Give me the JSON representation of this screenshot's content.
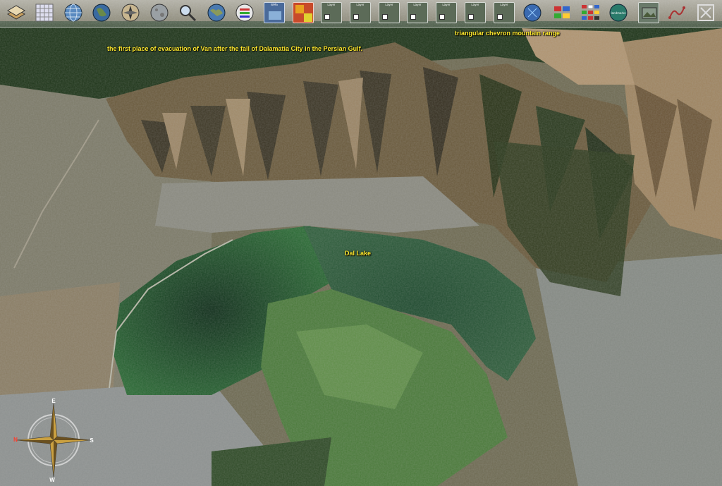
{
  "toolbar": {
    "buttons": [
      {
        "name": "layers-icon"
      },
      {
        "name": "grid-icon"
      },
      {
        "name": "globe-grid-icon"
      },
      {
        "name": "earth-icon"
      },
      {
        "name": "navigation-icon"
      },
      {
        "name": "moon-icon"
      },
      {
        "name": "search-icon"
      },
      {
        "name": "world-map-icon"
      },
      {
        "name": "wms-server-icon"
      }
    ],
    "layer_buttons": [
      {
        "name": "wms-layer-icon",
        "caption": "WMS"
      },
      {
        "name": "heatmap-layer-icon",
        "caption": ""
      },
      {
        "name": "layer-thumb-1-icon",
        "caption": "Layer"
      },
      {
        "name": "layer-thumb-2-icon",
        "caption": "Layer"
      },
      {
        "name": "layer-thumb-3-icon",
        "caption": "Layer"
      },
      {
        "name": "layer-thumb-4-icon",
        "caption": "Layer"
      },
      {
        "name": "layer-thumb-5-icon",
        "caption": "Layer"
      },
      {
        "name": "layer-thumb-6-icon",
        "caption": "Layer"
      },
      {
        "name": "layer-thumb-7-icon",
        "caption": "Layer"
      }
    ],
    "right_buttons": [
      {
        "name": "globe-overlay-icon"
      },
      {
        "name": "flags-icon"
      },
      {
        "name": "national-flags-icon"
      },
      {
        "name": "landmarks-icon",
        "caption": "landmarks"
      },
      {
        "name": "photo-layer-icon"
      },
      {
        "name": "route-icon"
      },
      {
        "name": "fullscreen-icon"
      }
    ]
  },
  "labels": {
    "evacuation": "the first place of evacuation of Van after the fall of Dalamatia City in the Persian Gulf.",
    "mountain": "triangular chevron mountain range",
    "lake": "Dal Lake"
  },
  "compass": {
    "north": "N",
    "east": "E",
    "south": "S",
    "west": "W"
  },
  "colors": {
    "label": "#ffea2e",
    "lake": "#1f4a2a",
    "mountain": "#6a5a3c",
    "urban": "#8a8e88"
  }
}
